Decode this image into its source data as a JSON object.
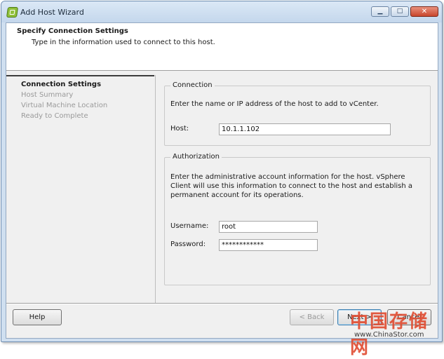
{
  "window": {
    "title": "Add Host Wizard"
  },
  "header": {
    "title": "Specify Connection Settings",
    "subtitle": "Type in the information used to connect to this host."
  },
  "steps": [
    {
      "label": "Connection Settings",
      "active": true
    },
    {
      "label": "Host Summary",
      "active": false
    },
    {
      "label": "Virtual Machine Location",
      "active": false
    },
    {
      "label": "Ready to Complete",
      "active": false
    }
  ],
  "connection": {
    "legend": "Connection",
    "description": "Enter the name or IP address of the host to add to vCenter.",
    "host_label": "Host:",
    "host_value": "10.1.1.102"
  },
  "authorization": {
    "legend": "Authorization",
    "description": "Enter the administrative account information for the host. vSphere Client will use this information to connect to the host and establish a permanent account for its operations.",
    "username_label": "Username:",
    "username_value": "root",
    "password_label": "Password:",
    "password_value": "************"
  },
  "buttons": {
    "help": "Help",
    "back": "< Back",
    "next": "Next >",
    "cancel": "Cancel"
  },
  "watermark": {
    "chinese": "中国存储网",
    "url": "www.ChinaStor.com"
  },
  "icons": {
    "app": "vsphere-app-icon",
    "minimize": "minimize-icon",
    "maximize": "maximize-icon",
    "close": "close-icon"
  }
}
